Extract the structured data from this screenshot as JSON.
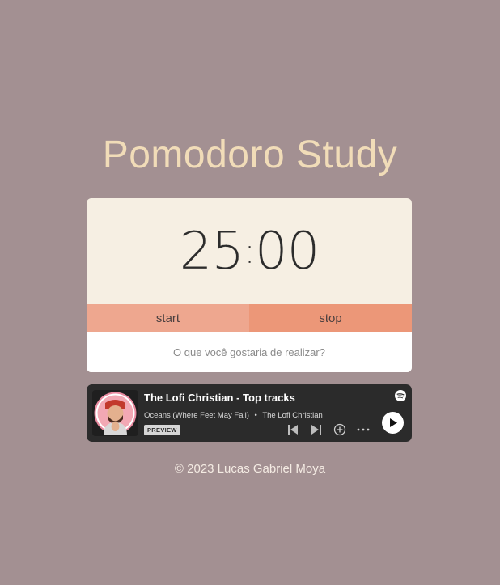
{
  "title": "Pomodoro Study",
  "timer": {
    "minutes": "25",
    "separator": ":",
    "seconds": "00"
  },
  "controls": {
    "start_label": "start",
    "stop_label": "stop"
  },
  "task": {
    "placeholder": "O que você gostaria de realizar?"
  },
  "player": {
    "playlist_title": "The Lofi Christian - Top tracks",
    "song": "Oceans (Where Feet May Fail)",
    "song_separator": "•",
    "artist": "The Lofi Christian",
    "preview_badge": "PREVIEW",
    "icons": [
      "spotify-icon",
      "previous-icon",
      "next-icon",
      "add-icon",
      "more-icon",
      "play-icon"
    ]
  },
  "footer": {
    "text": "© 2023 Lucas Gabriel Moya"
  },
  "colors": {
    "background": "#a39092",
    "title": "#f1dcb8",
    "card": "#f6efe3",
    "start_button": "#eea78f",
    "stop_button": "#ec9778",
    "player_bg": "#2b2b2b",
    "spotify_green": "#ffffff"
  }
}
